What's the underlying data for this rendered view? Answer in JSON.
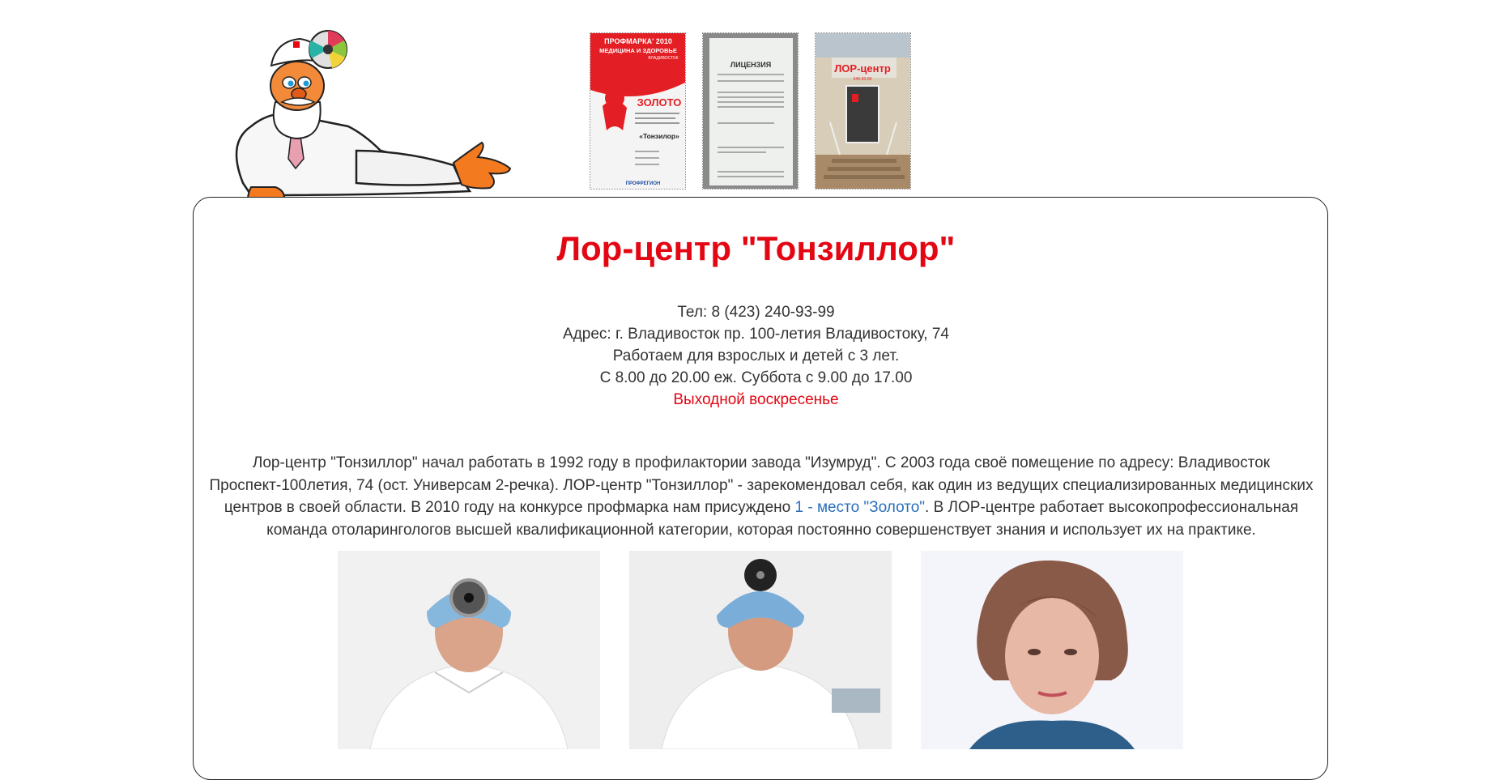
{
  "thumbnails": [
    {
      "kind": "award-diploma",
      "top_text": "ПРОФМАРКА' 2010",
      "sub_text": "МЕДИЦИНА И ЗДОРОВЬЕ",
      "city": "ВЛАДИВОСТОК",
      "award": "ЗОЛОТО",
      "name": "«Тонзилор»",
      "org": "ПРОФРЕГИОН"
    },
    {
      "kind": "license-document",
      "heading": "ЛИЦЕНЗИЯ"
    },
    {
      "kind": "clinic-entrance-photo",
      "sign": "ЛОР-центр",
      "phone_on_sign": "240-93-99"
    }
  ],
  "page": {
    "title": "Лор-центр \"Тонзиллор\"",
    "phone": "Тел: 8 (423) 240-93-99",
    "address": "Адрес: г. Владивосток пр. 100-летия Владивостоку, 74",
    "audience": "Работаем для взрослых и детей с 3 лет.",
    "hours": "С 8.00 до 20.00 еж. Суббота с 9.00 до 17.00",
    "closed": "Выходной воскресенье"
  },
  "about": {
    "text_before_link": "Лор-центр \"Тонзиллор\" начал работать в 1992 году в профилактории завода \"Изумруд\". С 2003 года своё помещение по адресу: Владивосток Проспект-100летия, 74 (ост. Универсам 2-речка). ЛОР-центр \"Тонзиллор\" - зарекомендовал себя, как один из ведущих специализированных медицинских центров в своей области. В 2010 году на конкурсе профмарка нам присуждено ",
    "link_text": "1 - место \"Золото\"",
    "text_after_link": ". В ЛОР-центре работает высокопрофессиональная команда отоларингологов высшей квалификационной категории, которая постоянно совершенствует знания и использует их на практике."
  },
  "colors": {
    "accent_red": "#e30613",
    "link_blue": "#2a6fbb",
    "text": "#333333",
    "border": "#222222"
  }
}
